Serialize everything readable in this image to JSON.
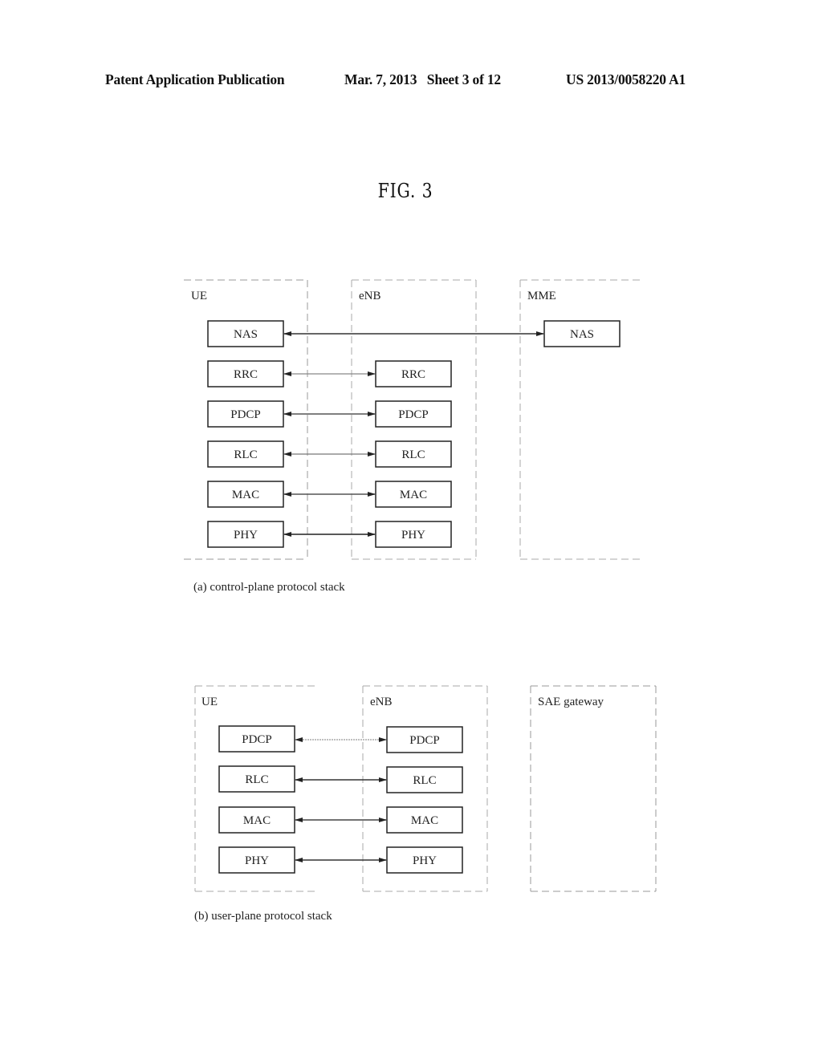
{
  "header": {
    "publication": "Patent Application Publication",
    "date_sheet": "Mar. 7, 2013   Sheet 3 of 12",
    "patent_number": "US 2013/0058220 A1"
  },
  "figure": {
    "title": "FIG. 3"
  },
  "control_plane": {
    "caption": "(a) control-plane protocol stack",
    "nodes": [
      {
        "label": "UE",
        "layers": [
          "NAS",
          "RRC",
          "PDCP",
          "RLC",
          "MAC",
          "PHY"
        ]
      },
      {
        "label": "eNB",
        "layers": [
          "RRC",
          "PDCP",
          "RLC",
          "MAC",
          "PHY"
        ]
      },
      {
        "label": "MME",
        "layers": [
          "NAS"
        ]
      }
    ],
    "links": [
      {
        "from": "UE",
        "to": "MME",
        "layer": "NAS"
      },
      {
        "from": "UE",
        "to": "eNB",
        "layer": "RRC"
      },
      {
        "from": "UE",
        "to": "eNB",
        "layer": "PDCP"
      },
      {
        "from": "UE",
        "to": "eNB",
        "layer": "RLC"
      },
      {
        "from": "UE",
        "to": "eNB",
        "layer": "MAC"
      },
      {
        "from": "UE",
        "to": "eNB",
        "layer": "PHY"
      }
    ]
  },
  "user_plane": {
    "caption": "(b) user-plane protocol stack",
    "nodes": [
      {
        "label": "UE",
        "layers": [
          "PDCP",
          "RLC",
          "MAC",
          "PHY"
        ]
      },
      {
        "label": "eNB",
        "layers": [
          "PDCP",
          "RLC",
          "MAC",
          "PHY"
        ]
      },
      {
        "label": "SAE gateway",
        "layers": []
      }
    ],
    "links": [
      {
        "from": "UE",
        "to": "eNB",
        "layer": "PDCP"
      },
      {
        "from": "UE",
        "to": "eNB",
        "layer": "RLC"
      },
      {
        "from": "UE",
        "to": "eNB",
        "layer": "MAC"
      },
      {
        "from": "UE",
        "to": "eNB",
        "layer": "PHY"
      }
    ]
  }
}
